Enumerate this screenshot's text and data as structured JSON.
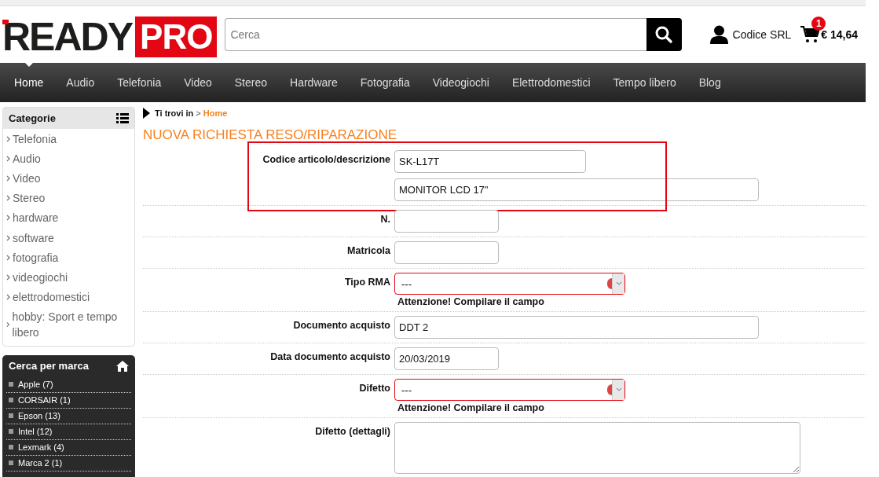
{
  "logo": {
    "left": "READY",
    "right": "PRO"
  },
  "search": {
    "placeholder": "Cerca"
  },
  "account": {
    "name": "Codice SRL"
  },
  "cart": {
    "count": "1",
    "total": "€ 14,64"
  },
  "nav": [
    {
      "label": "Home",
      "selected": true
    },
    {
      "label": "Audio",
      "selected": false
    },
    {
      "label": "Telefonia",
      "selected": false
    },
    {
      "label": "Video",
      "selected": false
    },
    {
      "label": "Stereo",
      "selected": false
    },
    {
      "label": "Hardware",
      "selected": false
    },
    {
      "label": "Fotografia",
      "selected": false
    },
    {
      "label": "Videogiochi",
      "selected": false
    },
    {
      "label": "Elettrodomestici",
      "selected": false
    },
    {
      "label": "Tempo libero",
      "selected": false
    },
    {
      "label": "Blog",
      "selected": false
    }
  ],
  "categories": {
    "title": "Categorie",
    "items": [
      "Telefonia",
      "Audio",
      "Video",
      "Stereo",
      "hardware",
      "software",
      "fotografia",
      "videogiochi",
      "elettrodomestici",
      "hobby: Sport e tempo libero"
    ]
  },
  "brands": {
    "title": "Cerca per marca",
    "items": [
      "Apple (7)",
      "CORSAIR (1)",
      "Epson (13)",
      "Intel (12)",
      "Lexmark (4)",
      "Marca 2 (1)"
    ]
  },
  "breadcrumb": {
    "prefix": "Ti trovi in",
    "separator": ">",
    "current": "Home"
  },
  "title": "NUOVA RICHIESTA RESO/RIPARAZIONE",
  "form": [
    {
      "label": "Codice articolo/descrizione",
      "highlighted": true,
      "fields": [
        {
          "kind": "short",
          "value": "SK-L17T"
        },
        {
          "kind": "long",
          "value": "MONITOR LCD 17\""
        }
      ]
    },
    {
      "label": "N.",
      "highlighted": false,
      "fields": [
        {
          "kind": "short"
        }
      ]
    },
    {
      "label": "Matricola",
      "highlighted": false,
      "fields": [
        {
          "kind": "short"
        }
      ]
    },
    {
      "label": "Tipo RMA",
      "highlighted": false,
      "fields": [
        {
          "kind": "select",
          "value": "---",
          "error": "Attenzione! Compilare il campo"
        }
      ]
    },
    {
      "label": "Documento acquisto",
      "highlighted": false,
      "fields": [
        {
          "kind": "long",
          "value": "DDT 2"
        }
      ]
    },
    {
      "label": "Data documento acquisto",
      "highlighted": false,
      "fields": [
        {
          "kind": "short",
          "value": "20/03/2019"
        }
      ]
    },
    {
      "label": "Difetto",
      "highlighted": false,
      "fields": [
        {
          "kind": "select",
          "value": "---",
          "error": "Attenzione! Compilare il campo"
        }
      ]
    },
    {
      "label": "Difetto (dettagli)",
      "highlighted": false,
      "fields": [
        {
          "kind": "textarea"
        }
      ]
    }
  ]
}
